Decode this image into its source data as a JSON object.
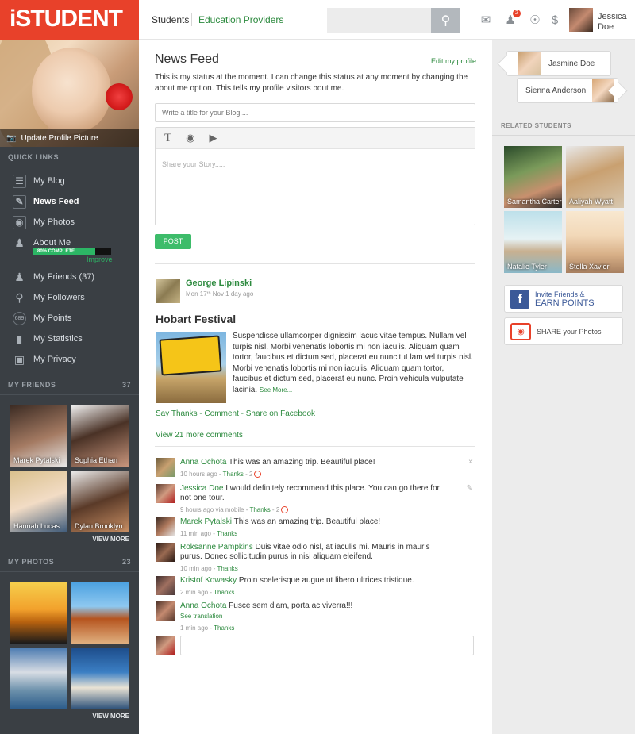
{
  "brand": {
    "logo_text": "iSTUDENT"
  },
  "profile": {
    "update_label": "Update Profile Picture"
  },
  "quick_links": {
    "heading": "QUICK LINKS",
    "items": [
      {
        "label": "My Blog",
        "icon": "list-icon"
      },
      {
        "label": "News Feed",
        "icon": "edit-icon"
      },
      {
        "label": "My Photos",
        "icon": "camera-icon"
      },
      {
        "label": "About Me",
        "icon": "user-icon"
      },
      {
        "label": "My Friends (37)",
        "icon": "friends-icon"
      },
      {
        "label": "My Followers",
        "icon": "followers-icon"
      },
      {
        "label": "My Points",
        "icon": "points-icon",
        "icon_text": "689"
      },
      {
        "label": "My Statistics",
        "icon": "bar-chart-icon"
      },
      {
        "label": "My Privacy",
        "icon": "lock-icon"
      }
    ],
    "about_progress": {
      "label": "80% COMPLETE",
      "percent": 80,
      "improve": "Improve"
    }
  },
  "my_friends": {
    "heading": "MY FRIENDS",
    "count": "37",
    "items": [
      "Marek Pytalski",
      "Sophia Ethan",
      "Hannah Lucas",
      "Dylan Brooklyn"
    ],
    "view_more": "VIEW MORE"
  },
  "my_photos": {
    "heading": "MY PHOTOS",
    "count": "23",
    "view_more": "VIEW MORE"
  },
  "topbar": {
    "tab_students": "Students",
    "tab_providers": "Education Providers",
    "notification_count": "2",
    "user_name": "Jessica Doe"
  },
  "feed": {
    "title": "News Feed",
    "edit_profile": "Edit my profile",
    "status": "This is my status at the moment. I can change this status at any moment by changing the about me option. This tells my profile visitors bout me.",
    "blog_title_placeholder": "Write a title for your Blog....",
    "story_placeholder": "Share your Story.....",
    "post_button": "POST"
  },
  "post": {
    "author": "George Lipinski",
    "date": "Mon 17ᵗʰ Nov  1 day ago",
    "title": "Hobart Festival",
    "body": "Suspendisse ullamcorper dignissim lacus vitae tempus. Nullam vel turpis nisl. Morbi venenatis lobortis mi non iaculis. Aliquam quam tortor, fauci­bus et dictum sed, placerat eu nuncituLlam vel turpis nisl. Morbi venena­tis lobortis mi non iaculis. Aliquam quam tortor, faucibus et dictum sed, placerat eu nunc. Proin vehicula vulputate lacinia.",
    "see_more": "See More...",
    "actions": "Say Thanks - Comment - Share on Facebook",
    "view_comments": "View 21 more comments",
    "image_sign": "BEWARE UNFENCED ROAD FOR NEXT 150km"
  },
  "comments": [
    {
      "name": "Anna Ochota",
      "text": "This was an amazing trip. Beautiful place!",
      "meta": "10 hours ago - ",
      "thanks": "Thanks",
      "sep": " - ",
      "count": "2",
      "tool": "×"
    },
    {
      "name": "Jessica Doe",
      "text": "I would definitely recommend this place. You can go there for not one tour.",
      "meta": "9 hours ago via mobile - ",
      "thanks": "Thanks",
      "sep": " - ",
      "count": "2",
      "tool": "✎"
    },
    {
      "name": "Marek Pytalski",
      "text": "This was an amazing trip. Beautiful place!",
      "meta": "11 min ago - ",
      "thanks": "Thanks"
    },
    {
      "name": "Roksanne Pampkins",
      "text": "Duis vitae odio nisl, at iaculis mi. Mauris in mauris purus. Donec sollicitudin purus in nisi aliquam eleifend.",
      "meta": "10 min ago - ",
      "thanks": "Thanks"
    },
    {
      "name": "Kristof Kowasky",
      "text": "Proin scelerisque augue ut libero ultrices tristique.",
      "meta": "2 min ago - ",
      "thanks": "Thanks"
    },
    {
      "name": "Anna Ochota",
      "text": "Fusce sem diam, porta ac viverra!!!",
      "translation": "See translation",
      "meta": "1 min ago - ",
      "thanks": "Thanks"
    }
  ],
  "right_panel": {
    "online": [
      "Jasmine Doe",
      "Sienna Anderson"
    ],
    "related_heading": "RELATED STUDENTS",
    "related": [
      "Samantha Carter",
      "Aaliyah Wyatt",
      "Natalie Tyler",
      "Stella Xavier"
    ],
    "invite_line1": "Invite Friends &",
    "invite_line2": "EARN POINTS",
    "share_label": "SHARE your Photos"
  },
  "colors": {
    "brand_red": "#e8412a",
    "accent_green": "#2c8a3e",
    "post_green": "#3dbc6a",
    "sidebar": "#3a3f44",
    "facebook": "#3b5998"
  }
}
